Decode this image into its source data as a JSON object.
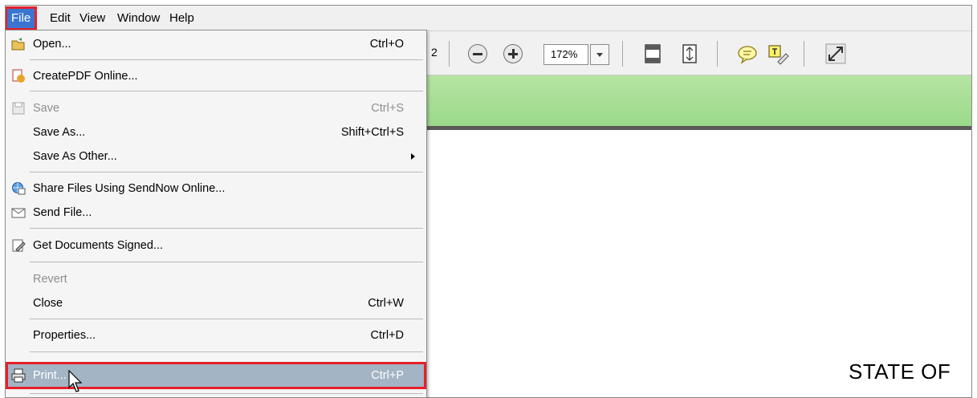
{
  "menubar": {
    "items": [
      "File",
      "Edit",
      "View",
      "Window",
      "Help"
    ]
  },
  "toolbar": {
    "page_fragment": "2",
    "zoom": "172%"
  },
  "document": {
    "title_fragment": "STATE OF"
  },
  "file_menu": {
    "items": [
      {
        "label": "Open...",
        "shortcut": "Ctrl+O",
        "icon": "open-folder-icon"
      },
      {
        "label": "CreatePDF Online...",
        "shortcut": "",
        "icon": "createpdf-icon"
      },
      {
        "label": "Save",
        "shortcut": "Ctrl+S",
        "icon": "save-icon",
        "disabled": true
      },
      {
        "label": "Save As...",
        "shortcut": "Shift+Ctrl+S"
      },
      {
        "label": "Save As Other...",
        "shortcut": "",
        "submenu": true
      },
      {
        "label": "Share Files Using SendNow Online...",
        "shortcut": "",
        "icon": "share-globe-icon"
      },
      {
        "label": "Send File...",
        "shortcut": "",
        "icon": "envelope-icon"
      },
      {
        "label": "Get Documents Signed...",
        "shortcut": "",
        "icon": "sign-icon"
      },
      {
        "label": "Revert",
        "shortcut": "",
        "disabled": true
      },
      {
        "label": "Close",
        "shortcut": "Ctrl+W"
      },
      {
        "label": "Properties...",
        "shortcut": "Ctrl+D"
      },
      {
        "label": "Print...",
        "shortcut": "Ctrl+P",
        "icon": "printer-icon",
        "highlighted": true
      }
    ]
  },
  "colors": {
    "highlight_outline": "#e5202a",
    "menu_file_active": "#3a76d0",
    "print_row_bg": "#a3b4c4",
    "green_bar": "#9bd98a"
  }
}
